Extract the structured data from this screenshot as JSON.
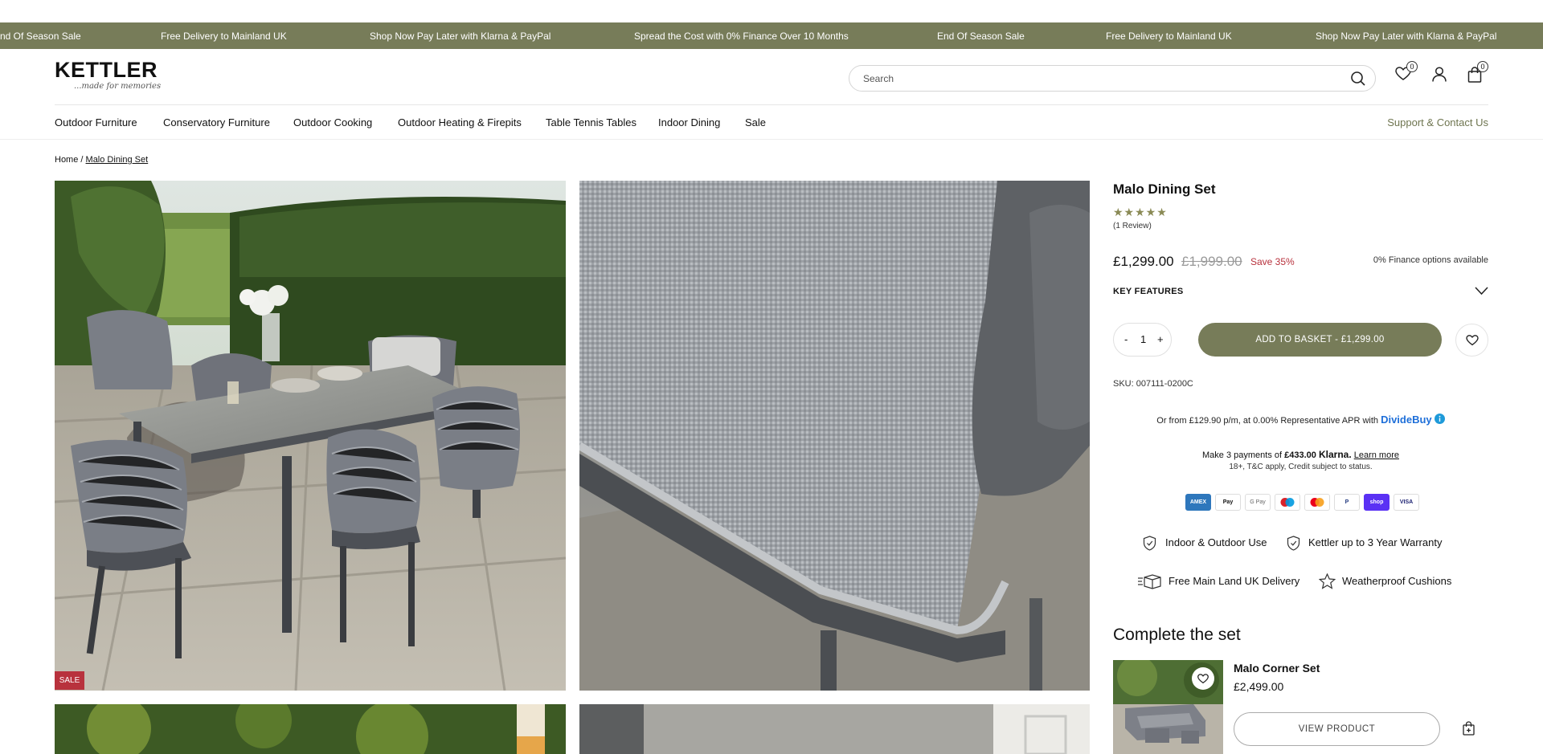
{
  "ticker": {
    "items": [
      "nd Of Season Sale",
      "Free Delivery to Mainland UK",
      "Shop Now Pay Later with Klarna & PayPal",
      "Spread the Cost with 0% Finance Over 10 Months",
      "End Of Season Sale",
      "Free Delivery to Mainland UK",
      "Shop Now Pay Later with Klarna & PayPal"
    ]
  },
  "header": {
    "logo_text": "KETTLER",
    "logo_tagline": "...made for memories",
    "search_placeholder": "Search",
    "wishlist_count": "0",
    "basket_count": "0"
  },
  "nav": {
    "items": [
      "Outdoor Furniture",
      "Conservatory Furniture",
      "Outdoor Cooking",
      "Outdoor Heating & Firepits",
      "Table Tennis Tables",
      "Indoor Dining",
      "Sale"
    ],
    "support": "Support & Contact Us"
  },
  "breadcrumb": {
    "home": "Home /",
    "current": "Malo Dining Set"
  },
  "gallery": {
    "sale_badge": "SALE"
  },
  "product": {
    "title": "Malo Dining Set",
    "rating": 5,
    "stars": "★★★★★",
    "reviews": "(1 Review)",
    "price": "£1,299.00",
    "was_price": "£1,999.00",
    "save": "Save 35%",
    "finance": "0% Finance options available",
    "key_features": "KEY FEATURES",
    "qty_minus": "-",
    "qty": "1",
    "qty_plus": "+",
    "add_to_basket": "ADD TO BASKET - £1,299.00",
    "sku": "SKU: 007111-0200C",
    "dividebuy_text": "Or from £129.90 p/m, at 0.00% Representative APR with",
    "dividebuy_brand": "DivideBuy",
    "klarna_pre": "Make 3 payments of",
    "klarna_amount": "£433.00",
    "klarna_brand": "Klarna.",
    "klarna_learn": "Learn more",
    "klarna_terms": "18+, T&C apply, Credit subject to status.",
    "payments": [
      "AMEX",
      "Pay",
      "G Pay",
      "",
      "",
      "P",
      "shop",
      "VISA"
    ],
    "features": [
      "Indoor & Outdoor Use",
      "Kettler up to 3 Year Warranty",
      "Free Main Land UK Delivery",
      "Weatherproof Cushions"
    ]
  },
  "complete_set": {
    "heading": "Complete the set",
    "item_name": "Malo Corner Set",
    "item_price": "£2,499.00",
    "view_button": "VIEW PRODUCT"
  },
  "colors": {
    "accent": "#777c59",
    "sale": "#b8323d",
    "dividebuy": "#1e6fd9"
  }
}
